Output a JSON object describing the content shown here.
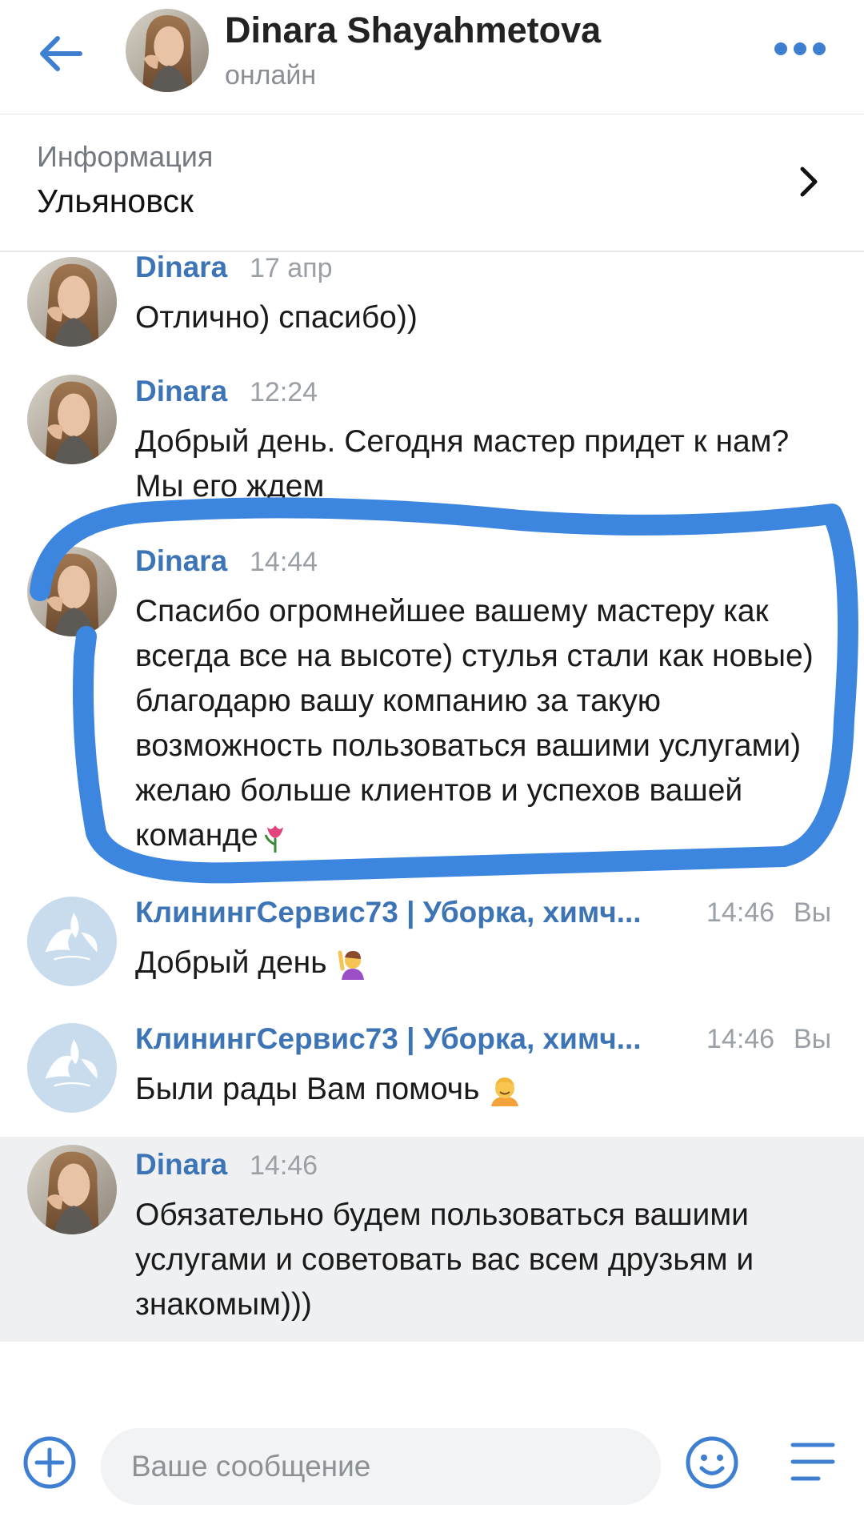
{
  "header": {
    "name": "Dinara Shayahmetova",
    "status": "онлайн"
  },
  "info": {
    "label": "Информация",
    "value": "Ульяновск"
  },
  "messages": [
    {
      "sender": "Dinara",
      "time": "17 апр",
      "text": "Отлично) спасибо))"
    },
    {
      "sender": "Dinara",
      "time": "12:24",
      "text": "Добрый день. Сегодня мастер придет к нам? Мы его ждем"
    },
    {
      "sender": "Dinara",
      "time": "14:44",
      "text": "Спасибо огромнейшее вашему мастеру как всегда все на высоте) стулья стали как новые) благодарю вашу компанию за такую возможность пользоваться вашими услугами) желаю больше клиентов и успехов вашей команде"
    },
    {
      "sender": "КлинингСервис73 | Уборка, химч...",
      "time": "14:46",
      "you": "Вы",
      "text": "Добрый день"
    },
    {
      "sender": "КлинингСервис73 | Уборка, химч...",
      "time": "14:46",
      "you": "Вы",
      "text": "Были рады Вам помочь"
    },
    {
      "sender": "Dinara",
      "time": "14:46",
      "text": "Обязательно будем пользоваться вашими услугами и советовать вас всем друзьям и знакомым)))"
    }
  ],
  "composer": {
    "placeholder": "Ваше сообщение"
  },
  "icons": [
    "back-arrow-icon",
    "more-icon",
    "chevron-right-icon",
    "plus-icon",
    "smile-icon",
    "menu-icon",
    "tulip-icon",
    "raising-hand-icon",
    "smiling-face-icon"
  ],
  "colors": {
    "accent": "#3f7fd1",
    "sender": "#3d74b5",
    "highlight_bg": "#eef0f2",
    "scribble": "#3d86e0"
  }
}
